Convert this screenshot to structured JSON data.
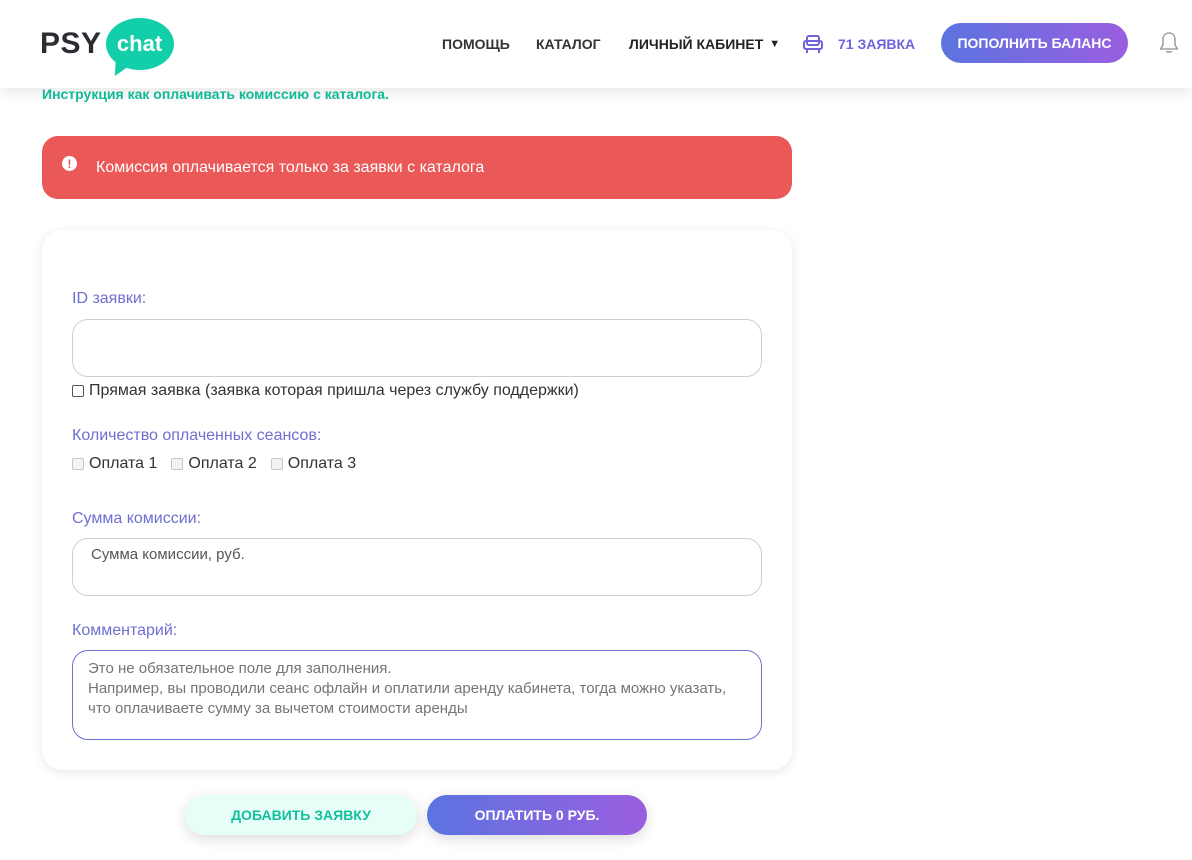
{
  "header": {
    "logo": {
      "psy": "PSY",
      "chat": "chat"
    },
    "nav": [
      {
        "label": "ПОМОЩЬ"
      },
      {
        "label": "КАТАЛОГ"
      },
      {
        "label": "ЛИЧНЫЙ КАБИНЕТ",
        "caret": "▼"
      }
    ],
    "requests": {
      "icon": "armchair-icon",
      "label": "71 ЗАЯВКА"
    },
    "topup_button": "ПОПОЛНИТЬ БАЛАНС",
    "notifications_icon": "bell-icon"
  },
  "instruction_link": "Инструкция как оплачивать комиссию с каталога.",
  "alert": {
    "icon": "!",
    "text": "Комиссия оплачивается только за заявки с каталога"
  },
  "form": {
    "id_label": "ID заявки:",
    "id_value": "",
    "direct_request_label": "Прямая заявка (заявка которая пришла через службу поддержки)",
    "direct_request_checked": false,
    "sessions_label": "Количество оплаченных сеансов:",
    "sessions": [
      {
        "label": "Оплата 1",
        "checked": false
      },
      {
        "label": "Оплата 2",
        "checked": false
      },
      {
        "label": "Оплата 3",
        "checked": false
      }
    ],
    "sum_label": "Сумма комиссии:",
    "sum_placeholder": "Сумма комиссии, руб.",
    "comment_label": "Комментарий:",
    "comment_placeholder": "Это не обязательное поле для заполнения.\nНапример, вы проводили сеанс офлайн и оплатили аренду кабинета, тогда можно указать, что оплачиваете сумму за вычетом стоимости аренды"
  },
  "actions": {
    "add_request": "ДОБАВИТЬ ЗАЯВКУ",
    "pay": "ОПЛАТИТЬ 0 РУБ."
  },
  "colors": {
    "brand_green": "#12cfa9",
    "accent_purple": "#6f63dc",
    "alert_red": "#ea5858",
    "gradient_start": "#5b74e0",
    "gradient_end": "#9a5ee0"
  }
}
